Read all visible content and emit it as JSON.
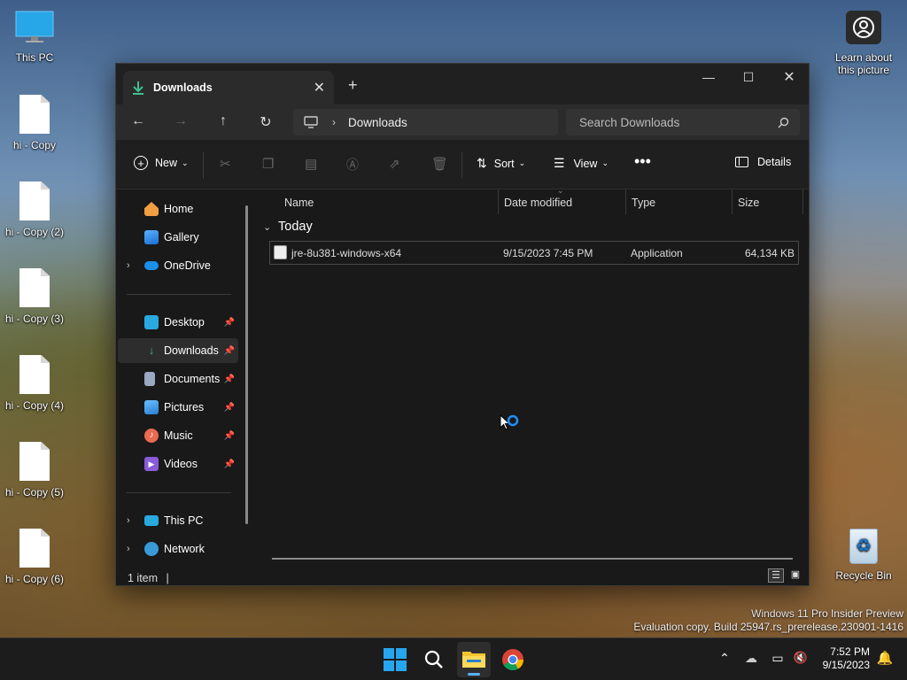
{
  "desktop": {
    "icons": [
      {
        "label": "This PC"
      },
      {
        "label": "hi - Copy"
      },
      {
        "label": "hi - Copy (2)"
      },
      {
        "label": "hi - Copy (3)"
      },
      {
        "label": "hi - Copy (4)"
      },
      {
        "label": "hi - Copy (5)"
      },
      {
        "label": "hi - Copy (6)"
      }
    ],
    "learn_about": "Learn about this picture",
    "recycle_bin": "Recycle Bin",
    "watermark_line1": "Windows 11 Pro Insider Preview",
    "watermark_line2": "Evaluation copy. Build 25947.rs_prerelease.230901-1416"
  },
  "window": {
    "tab_title": "Downloads",
    "address": {
      "segment": "Downloads"
    },
    "search_placeholder": "Search Downloads",
    "command_bar": {
      "new_label": "New",
      "sort_label": "Sort",
      "view_label": "View",
      "details_label": "Details"
    },
    "sidebar": {
      "items": [
        {
          "label": "Home",
          "icon": "home-icon"
        },
        {
          "label": "Gallery",
          "icon": "gallery-icon"
        },
        {
          "label": "OneDrive",
          "icon": "onedrive-icon"
        },
        {
          "label": "Desktop",
          "icon": "desktop-icon"
        },
        {
          "label": "Downloads",
          "icon": "downloads-icon"
        },
        {
          "label": "Documents",
          "icon": "documents-icon"
        },
        {
          "label": "Pictures",
          "icon": "pictures-icon"
        },
        {
          "label": "Music",
          "icon": "music-icon"
        },
        {
          "label": "Videos",
          "icon": "videos-icon"
        },
        {
          "label": "This PC",
          "icon": "pc-icon"
        },
        {
          "label": "Network",
          "icon": "network-icon"
        }
      ]
    },
    "columns": {
      "name": "Name",
      "date": "Date modified",
      "type": "Type",
      "size": "Size"
    },
    "group": "Today",
    "files": [
      {
        "name": "jre-8u381-windows-x64",
        "date": "9/15/2023 7:45 PM",
        "type": "Application",
        "size": "64,134 KB"
      }
    ],
    "status": "1 item"
  },
  "taskbar": {
    "time": "7:52 PM",
    "date": "9/15/2023"
  },
  "colors": {
    "accent": "#0078d4",
    "window_bg": "#191919",
    "taskbar_bg": "#1c1c1c"
  }
}
